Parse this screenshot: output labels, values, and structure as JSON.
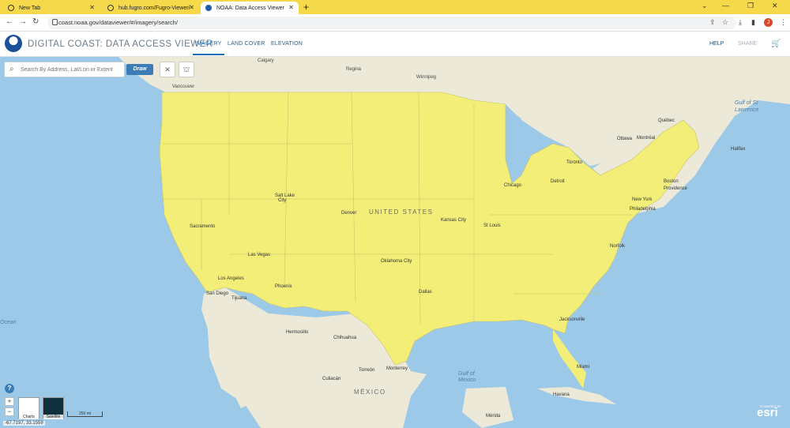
{
  "browser": {
    "tabs": [
      {
        "title": "New Tab"
      },
      {
        "title": "hub.fugro.com/Fugro-Viewer/"
      },
      {
        "title": "NOAA: Data Access Viewer"
      }
    ],
    "url": "coast.noaa.gov/dataviewer/#/imagery/search/",
    "profile_initial": "J"
  },
  "app": {
    "title": "DIGITAL COAST: DATA ACCESS VIEWER",
    "menu": [
      "IMAGERY",
      "LAND COVER",
      "ELEVATION"
    ],
    "selected_menu": "IMAGERY",
    "help": "HELP",
    "share": "SHARE"
  },
  "search": {
    "placeholder": "Search By Address, Lat/Lon or Extent",
    "draw_label": "Draw"
  },
  "map": {
    "country_label": "UNITED STATES",
    "mexico_label": "MÉXICO",
    "labels": {
      "calgary": "Calgary",
      "regina": "Regina",
      "winnipeg": "Winnipeg",
      "vancouver": "Vancouver",
      "gulf_st": "Gulf of St",
      "lawrence": "Lawrence",
      "quebec": "Québec",
      "ottawa": "Ottawa",
      "montreal": "Montréal",
      "halifax": "Halifax",
      "toronto": "Toronto",
      "detroit": "Detroit",
      "chicago": "Chicago",
      "boston": "Boston",
      "providence": "Providence",
      "new_york": "New York",
      "philadelphia": "Philadelphia",
      "norfolk": "Norfolk",
      "salt_lake": "Salt Lake",
      "city": "City",
      "denver": "Denver",
      "kansas_city": "Kansas City",
      "st_louis": "St Louis",
      "sacramento": "Sacramento",
      "las_vegas": "Las Vegas",
      "los_angeles": "Los Angeles",
      "san_diego": "San Diego",
      "tijuana": "Tijuana",
      "phoenix": "Phoenix",
      "oklahoma_city": "Oklahoma City",
      "dallas": "Dallas",
      "jacksonville": "Jacksonville",
      "miami": "Miami",
      "hermosillo": "Hermosillo",
      "chihuahua": "Chihuahua",
      "monterrey": "Monterrey",
      "torreon": "Torreón",
      "culiacan": "Culiacán",
      "havana": "Havana",
      "merida": "Mérida",
      "gulf_of": "Gulf of",
      "mexico": "Mexico",
      "ocean": "Ocean"
    },
    "scale": "250 mi",
    "coordinates": "-67.7197, 33.1559",
    "basemaps": [
      "Charts",
      "Satellite"
    ],
    "attribution": "esri",
    "powered_by": "POWERED BY"
  },
  "colors": {
    "coverage": "#f2ee78",
    "water": "#9cc9e8",
    "land": "#ece9d8",
    "accent": "#1d6db0"
  }
}
